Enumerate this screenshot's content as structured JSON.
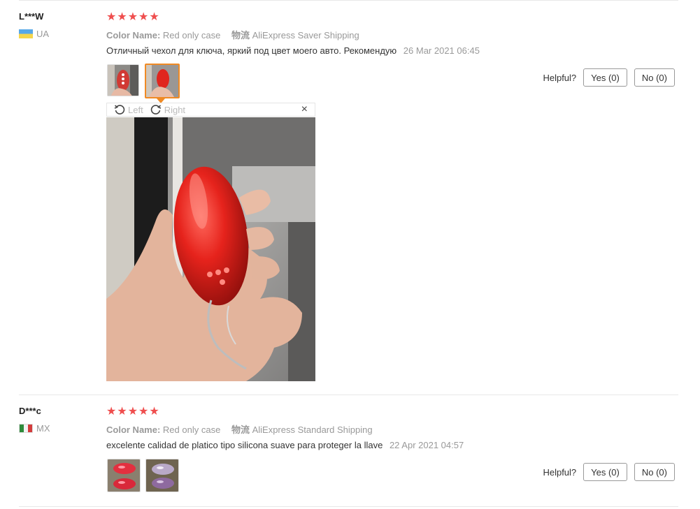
{
  "reviews": [
    {
      "user": "L***W",
      "country": "UA",
      "stars": "★★★★★",
      "color_label": "Color Name:",
      "color_value": "Red only case",
      "logistics_label": "物流",
      "logistics_value": "AliExpress Saver Shipping",
      "comment": "Отличный чехол для ключа, яркий под цвет моего авто. Рекомендую",
      "date": "26 Mar 2021 06:45",
      "helpful_label": "Helpful?",
      "yes_label": "Yes (0)",
      "no_label": "No (0)"
    },
    {
      "user": "D***c",
      "country": "MX",
      "stars": "★★★★★",
      "color_label": "Color Name:",
      "color_value": "Red only case",
      "logistics_label": "物流",
      "logistics_value": "AliExpress Standard Shipping",
      "comment": "excelente calidad de platico tipo silicona suave para proteger la llave",
      "date": "22 Apr 2021 04:57",
      "helpful_label": "Helpful?",
      "yes_label": "Yes (0)",
      "no_label": "No (0)"
    }
  ],
  "viewer": {
    "rotate_left": "Left",
    "rotate_right": "Right",
    "close": "×"
  },
  "colors": {
    "star": "#ef4e4e",
    "active_border": "#f08a24",
    "muted_text": "#999999"
  }
}
